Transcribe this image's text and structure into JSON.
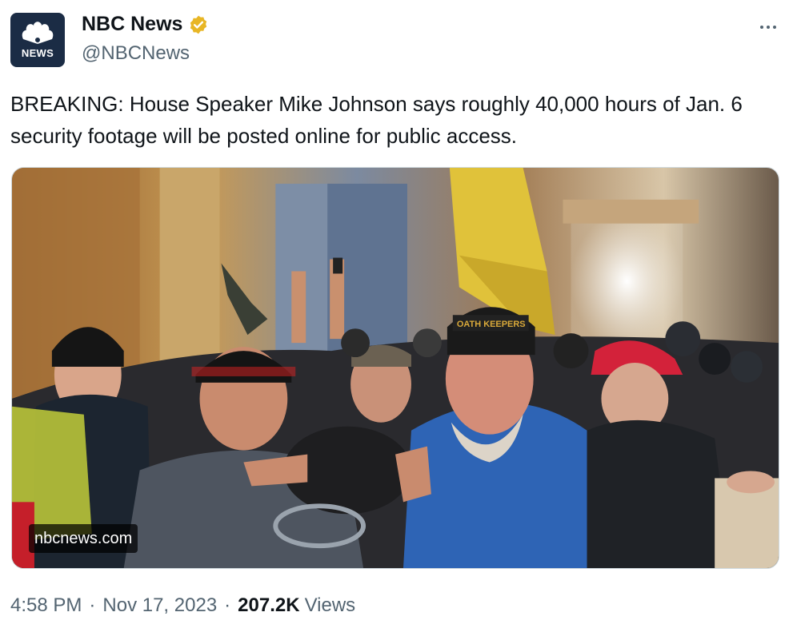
{
  "author": {
    "display_name": "NBC News",
    "handle": "@NBCNews",
    "avatar_text": "NEWS",
    "verified_color": "#e8b625"
  },
  "tweet": {
    "text": "BREAKING: House Speaker Mike Johnson says roughly 40,000 hours of Jan. 6 security footage will be posted online for public access."
  },
  "media": {
    "watermark": "nbcnews.com",
    "hat_text": "OATH KEEPERS"
  },
  "meta": {
    "time": "4:58 PM",
    "separator": "·",
    "date": "Nov 17, 2023",
    "views_count": "207.2K",
    "views_label": "Views"
  },
  "icons": [
    "nbc-peacock-icon",
    "verified-badge-icon",
    "more-options-icon"
  ],
  "colors": {
    "text_primary": "#0f1419",
    "text_secondary": "#536471",
    "avatar_bg": "#1b2c45"
  }
}
